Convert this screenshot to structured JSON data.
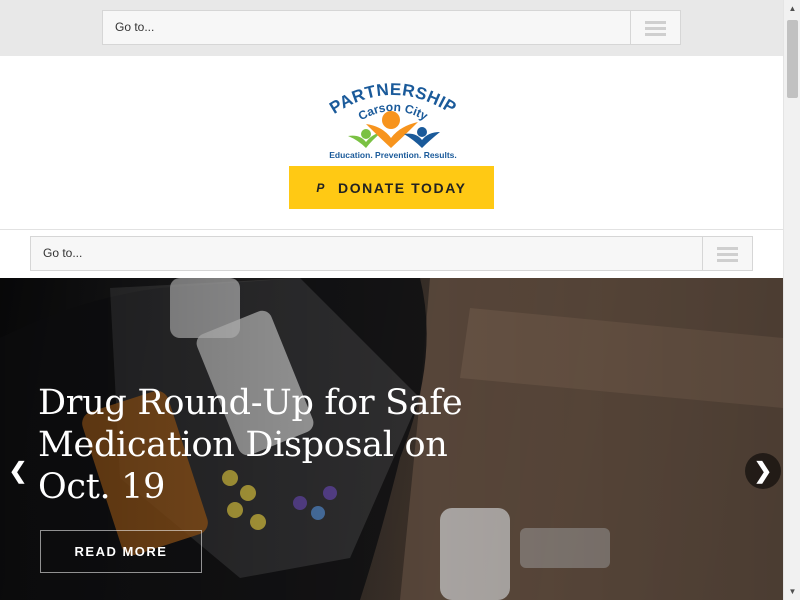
{
  "nav": {
    "goto_label": "Go to..."
  },
  "logo": {
    "line1": "PARTNERSHIP",
    "line2": "Carson City",
    "tagline": "Education. Prevention. Results."
  },
  "header": {
    "donate_label": "DONATE TODAY",
    "donate_icon": "paypal-icon"
  },
  "hero": {
    "title": "Drug Round-Up for Safe Medication Disposal on Oct. 19",
    "cta_label": "READ MORE",
    "prev_icon": "chevron-left-icon",
    "next_icon": "chevron-right-icon"
  },
  "colors": {
    "donate_bg": "#ffc914",
    "logo_blue": "#1a5a9a",
    "logo_orange": "#f7941d",
    "logo_green": "#7ac143"
  }
}
